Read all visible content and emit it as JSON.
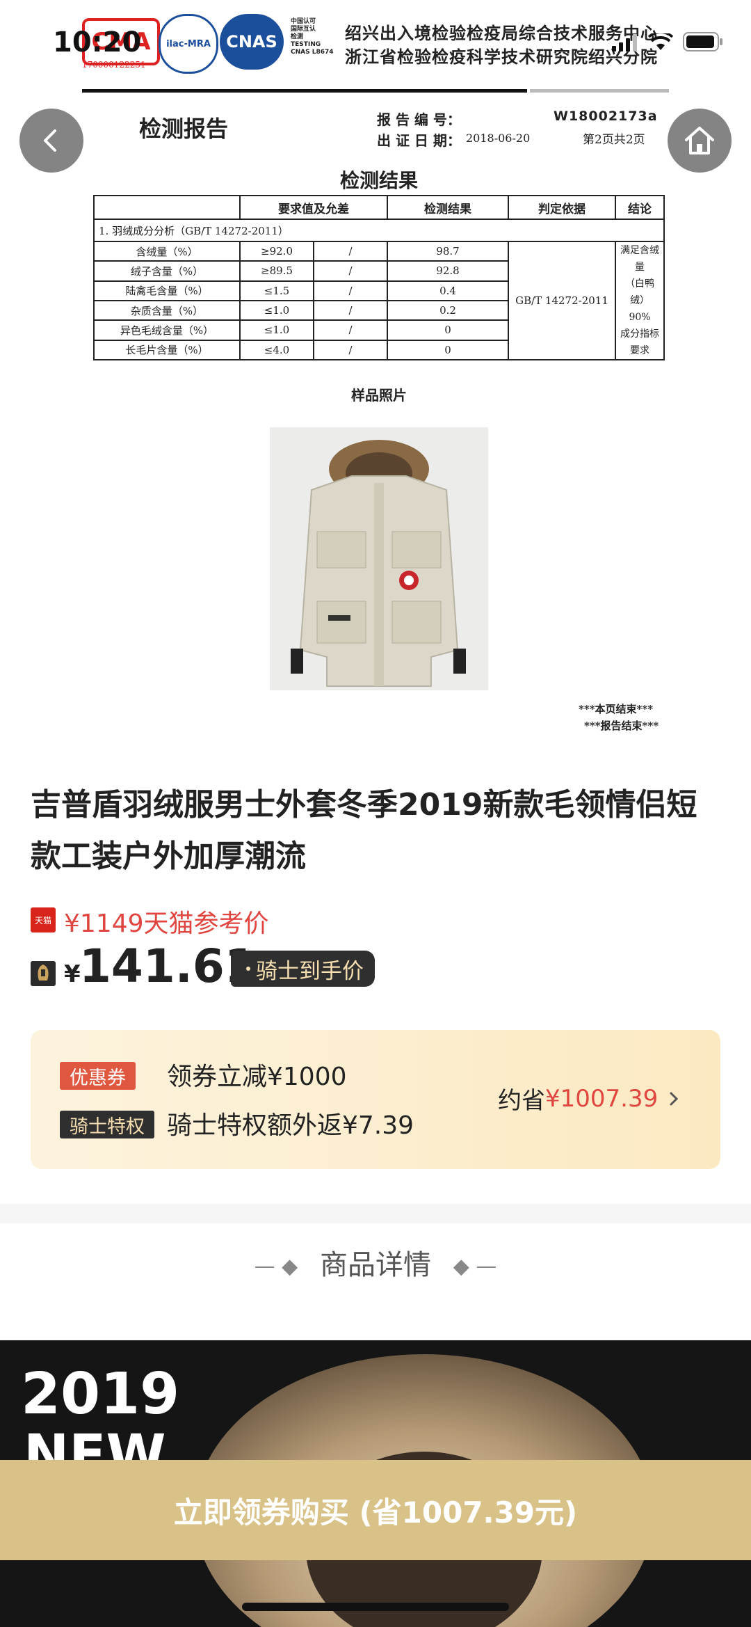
{
  "status_bar": {
    "time": "10:20"
  },
  "report": {
    "logos": [
      "CMA",
      "ilac-MRA",
      "CNAS"
    ],
    "cma_number": "170000122251",
    "cnas_small": [
      "中国认可",
      "国际互认",
      "检测",
      "TESTING",
      "CNAS L8674"
    ],
    "org_line1": "绍兴出入境检验检疫局综合技术服务中心",
    "org_line2": "浙江省检验检疫科学技术研究院绍兴分院",
    "doc_title": "检测报告",
    "report_no_label": "报 告 编 号：",
    "report_no": "W18002173a",
    "issue_date_label": "出 证 日 期：",
    "issue_date": "2018-06-20",
    "page_info": "第2页共2页",
    "section_title": "检测结果",
    "table_headers": [
      "",
      "要求值及允差",
      "检测结果",
      "判定依据",
      "结论"
    ],
    "table_section": "1. 羽绒成分分析（GB/T 14272-2011）",
    "rows": [
      {
        "item": "含绒量（%）",
        "req": "≥92.0",
        "tol": "/",
        "result": "98.7"
      },
      {
        "item": "绒子含量（%）",
        "req": "≥89.5",
        "tol": "/",
        "result": "92.8"
      },
      {
        "item": "陆禽毛含量（%）",
        "req": "≤1.5",
        "tol": "/",
        "result": "0.4"
      },
      {
        "item": "杂质含量（%）",
        "req": "≤1.0",
        "tol": "/",
        "result": "0.2"
      },
      {
        "item": "异色毛绒含量（%）",
        "req": "≤1.0",
        "tol": "/",
        "result": "0"
      },
      {
        "item": "长毛片含量（%）",
        "req": "≤4.0",
        "tol": "/",
        "result": "0"
      }
    ],
    "basis": "GB/T 14272-2011",
    "conclusion": [
      "满足含绒量",
      "（白鸭绒）90%",
      "成分指标要求"
    ],
    "photo_label": "样品照片",
    "end_page": "***本页结束***",
    "end_report": "***报告结束***"
  },
  "product": {
    "title": "吉普盾羽绒服男士外套冬季2019新款毛领情侣短款工装户外加厚潮流",
    "tmall_tag": "天猫",
    "tmall_price": "¥1149天猫参考价",
    "currency": "¥",
    "price": "141.61",
    "knight_price_label": "骑士到手价"
  },
  "coupon": {
    "coupon_tag": "优惠券",
    "coupon_text": "领券立减¥1000",
    "knight_tag": "骑士特权",
    "knight_text": "骑士特权额外返¥7.39",
    "save_label": "约省",
    "save_amount": "¥1007.39"
  },
  "detail_title": "商品详情",
  "banner": {
    "year": "2019",
    "new": "NEW"
  },
  "buy_button": "立即领券购买 (省1007.39元)",
  "colors": {
    "accent_red": "#e0463f",
    "gold": "#d9c288",
    "dark": "#2f2f2f"
  }
}
